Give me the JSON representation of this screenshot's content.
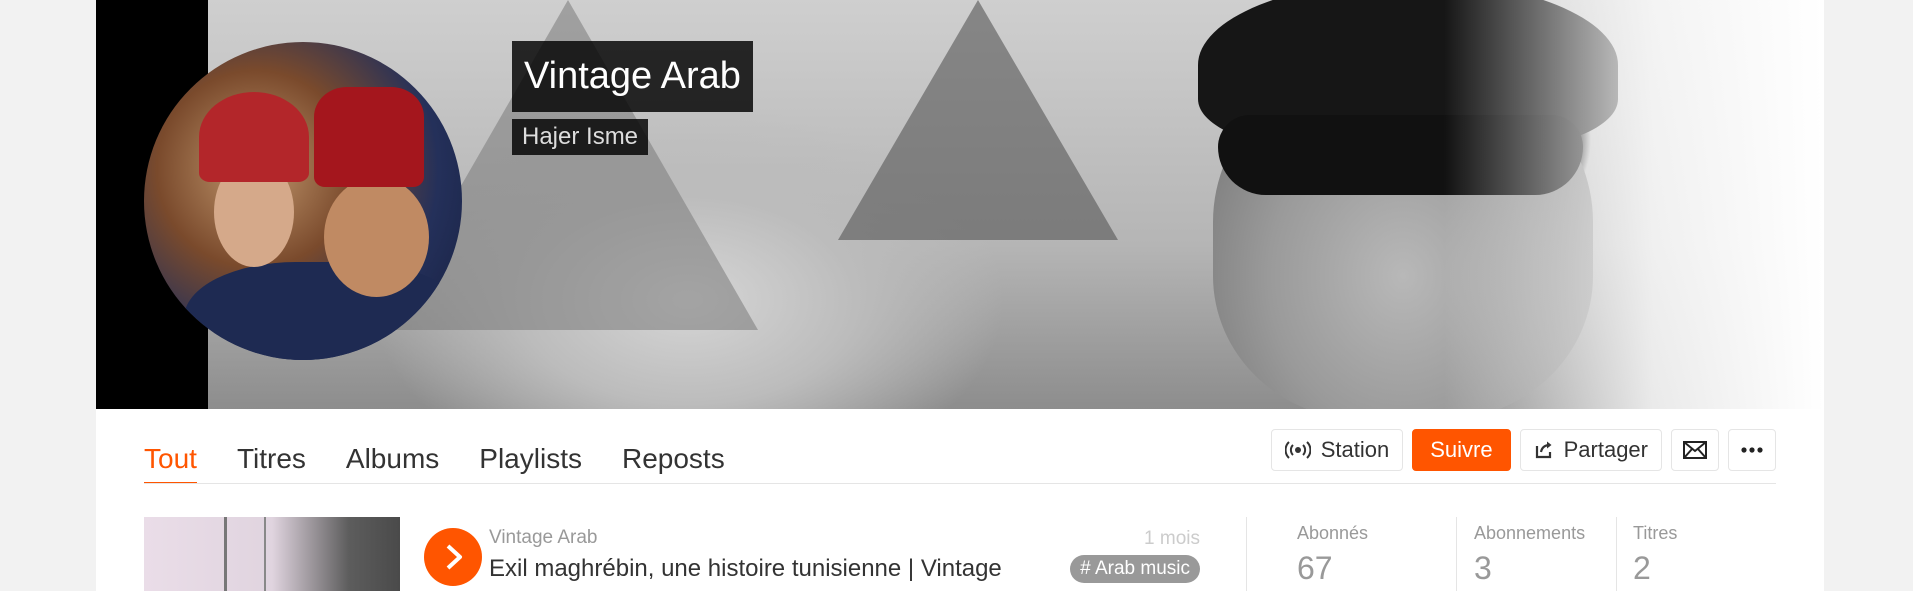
{
  "profile": {
    "name": "Vintage Arab",
    "owner": "Hajer Isme"
  },
  "tabs": [
    {
      "label": "Tout",
      "active": true
    },
    {
      "label": "Titres",
      "active": false
    },
    {
      "label": "Albums",
      "active": false
    },
    {
      "label": "Playlists",
      "active": false
    },
    {
      "label": "Reposts",
      "active": false
    }
  ],
  "actions": {
    "station_label": "Station",
    "follow_label": "Suivre",
    "share_label": "Partager",
    "message_icon": "envelope-icon",
    "more_icon": "more-icon"
  },
  "track": {
    "uploader": "Vintage Arab",
    "title": "Exil maghrébin, une histoire tunisienne | Vintage",
    "posted": "1 mois",
    "tag": "# Arab music"
  },
  "stats": [
    {
      "label": "Abonnés",
      "value": "67"
    },
    {
      "label": "Abonnements",
      "value": "3"
    },
    {
      "label": "Titres",
      "value": "2"
    }
  ],
  "colors": {
    "accent": "#ff5500",
    "text": "#333333",
    "muted": "#999999"
  }
}
